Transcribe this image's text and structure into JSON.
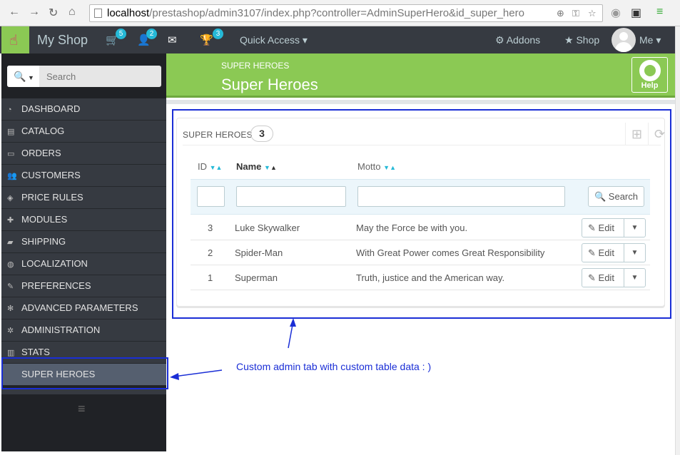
{
  "browser": {
    "url_host": "localhost",
    "url_path": "/prestashop/admin3107/index.php?controller=AdminSuperHero&id_super_hero"
  },
  "header": {
    "shop_name": "My Shop",
    "orders_badge": "5",
    "customers_badge": "2",
    "trophy_badge": "3",
    "quick_access": "Quick Access",
    "addons": "Addons",
    "shop": "Shop",
    "me": "Me"
  },
  "sidebar": {
    "search_placeholder": "Search",
    "items": [
      {
        "label": "DASHBOARD",
        "icon": "dashboard-icon"
      },
      {
        "label": "CATALOG",
        "icon": "book-icon"
      },
      {
        "label": "ORDERS",
        "icon": "credit-card-icon"
      },
      {
        "label": "CUSTOMERS",
        "icon": "users-icon"
      },
      {
        "label": "PRICE RULES",
        "icon": "tags-icon"
      },
      {
        "label": "MODULES",
        "icon": "puzzle-icon"
      },
      {
        "label": "SHIPPING",
        "icon": "truck-icon"
      },
      {
        "label": "LOCALIZATION",
        "icon": "globe-icon"
      },
      {
        "label": "PREFERENCES",
        "icon": "wrench-icon"
      },
      {
        "label": "ADVANCED PARAMETERS",
        "icon": "cogs-icon"
      },
      {
        "label": "ADMINISTRATION",
        "icon": "cog-icon"
      },
      {
        "label": "STATS",
        "icon": "bar-chart-icon"
      },
      {
        "label": "SUPER HEROES",
        "icon": ""
      }
    ]
  },
  "page": {
    "breadcrumb": "SUPER HEROES",
    "title": "Super Heroes",
    "help": "Help"
  },
  "panel": {
    "title": "SUPER HEROES",
    "count": "3",
    "columns": {
      "id": "ID",
      "name": "Name",
      "motto": "Motto"
    },
    "search_button": "Search",
    "edit_label": "Edit",
    "rows": [
      {
        "id": "3",
        "name": "Luke Skywalker",
        "motto": "May the Force be with you."
      },
      {
        "id": "2",
        "name": "Spider-Man",
        "motto": "With Great Power comes Great Responsibility"
      },
      {
        "id": "1",
        "name": "Superman",
        "motto": "Truth, justice and the American way."
      }
    ]
  },
  "annotation": {
    "text": "Custom admin tab with custom table data : )",
    "color": "#1a2ed6"
  },
  "colors": {
    "accent_green": "#8bc954",
    "header_dark": "#363a41",
    "sidebar_dark": "#202226",
    "badge_blue": "#25b9d7"
  }
}
